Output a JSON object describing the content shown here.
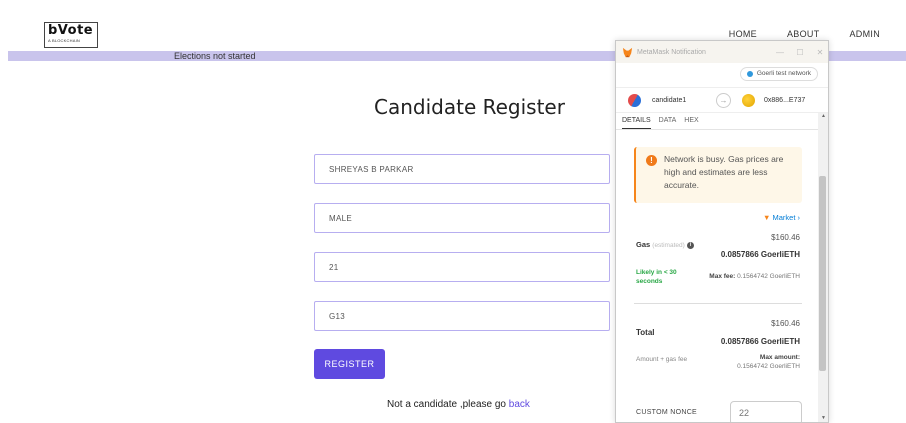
{
  "header": {
    "logo_text": "bVote",
    "logo_subtext": "A BLOCKCHAIN",
    "nav": {
      "home": "HOME",
      "about": "ABOUT",
      "admin": "ADMIN"
    }
  },
  "status": {
    "text": "Elections not started"
  },
  "form": {
    "title": "Candidate Register",
    "name_value": "SHREYAS B PARKAR",
    "gender_value": "MALE",
    "age_value": "21",
    "id_value": "G13",
    "register_label": "REGISTER",
    "back_text": "Not a candidate ,please go",
    "back_link": "back"
  },
  "metamask": {
    "window_title": "MetaMask Notification",
    "window_controls": {
      "minimize": "—",
      "maximize": "☐",
      "close": "✕"
    },
    "network": "Goerli test network",
    "from_account": "candidate1",
    "to_account": "0x886...E737",
    "tabs": {
      "details": "DETAILS",
      "data": "DATA",
      "hex": "HEX"
    },
    "warning": "Network is busy. Gas prices are high and estimates are less accurate.",
    "market": "Market",
    "gas_label": "Gas",
    "gas_estimated": "(estimated)",
    "gas_usd": "$160.46",
    "gas_eth": "0.0857866 GoerliETH",
    "likely": "Likely in < 30 seconds",
    "max_fee_label": "Max fee:",
    "max_fee_value": "0.1564742 GoerliETH",
    "total_label": "Total",
    "total_usd": "$160.46",
    "total_eth": "0.0857866 GoerliETH",
    "amount_label": "Amount + gas fee",
    "max_amount_label": "Max amount:",
    "max_amount_value": "0.1564742 GoerliETH",
    "nonce_label": "CUSTOM NONCE",
    "nonce_placeholder": "22"
  },
  "colors": {
    "accent": "#5f4ae0",
    "status_bar": "#c9c4ec",
    "field_border": "#b7aef0",
    "warning_bg": "#fef7e8",
    "metamask_orange": "#f6851b",
    "success_green": "#28a745"
  }
}
